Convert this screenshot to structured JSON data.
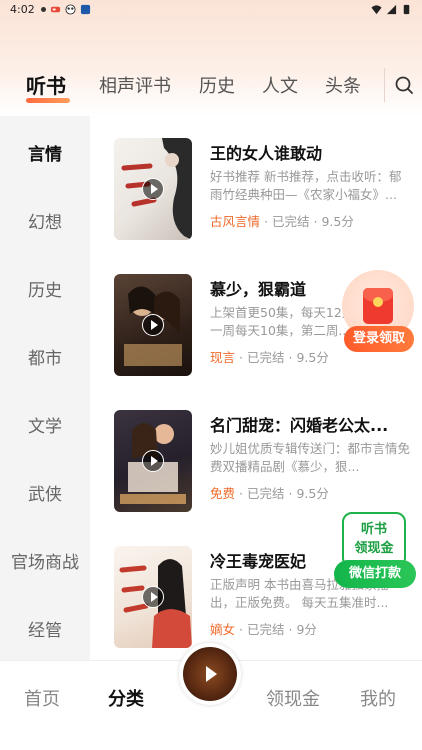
{
  "status_bar": {
    "time": "4:02",
    "icons": [
      "dot-icon",
      "game-icon",
      "panda-icon",
      "box-icon",
      "wifi-icon",
      "signal-icon",
      "battery-icon"
    ]
  },
  "top_tabs": {
    "items": [
      {
        "label": "听书",
        "active": true
      },
      {
        "label": "相声评书",
        "active": false
      },
      {
        "label": "历史",
        "active": false
      },
      {
        "label": "人文",
        "active": false
      },
      {
        "label": "头条",
        "active": false
      }
    ],
    "search_icon": "search-icon"
  },
  "categories": {
    "items": [
      {
        "label": "言情",
        "active": true
      },
      {
        "label": "幻想",
        "active": false
      },
      {
        "label": "历史",
        "active": false
      },
      {
        "label": "都市",
        "active": false
      },
      {
        "label": "文学",
        "active": false
      },
      {
        "label": "武侠",
        "active": false
      },
      {
        "label": "官场商战",
        "active": false
      },
      {
        "label": "经管",
        "active": false
      }
    ]
  },
  "books": [
    {
      "title": "王的女人谁敢动",
      "desc": "好书推荐 新书推荐，点击收听：郁雨竹经典种田—《农家小福女》...",
      "category": "古风言情",
      "status": "已完结",
      "score": "9.5分",
      "cover_colors": [
        "#f3f1ec",
        "#b8322c"
      ]
    },
    {
      "title": "慕少，狠霸道",
      "desc": "上架首更50集，每天12点更新，第一周每天10集，第二周...",
      "category": "现言",
      "status": "已完结",
      "score": "9.5分",
      "cover_colors": [
        "#3a2a22",
        "#e2b070"
      ]
    },
    {
      "title": "名门甜宠：闪婚老公太...",
      "desc": "妙儿姐优质专辑传送门：都市言情免费双播精品剧《慕少，狠...",
      "category": "免费",
      "status": "已完结",
      "score": "9.5分",
      "cover_colors": [
        "#2a2632",
        "#f0c4a8"
      ]
    },
    {
      "title": "冷王毒宠医妃",
      "desc": "正版声明 本书由喜马拉雅独家播出，正版免费。 每天五集准时...",
      "category": "嫡女",
      "status": "已完结",
      "score": "9分",
      "cover_colors": [
        "#f4ede6",
        "#c23a2c"
      ]
    }
  ],
  "meta_separator": "·",
  "floating_redpacket": {
    "label": "登录领取",
    "icon": "red-envelope-icon"
  },
  "floating_cash": {
    "line1": "听书",
    "line2": "领现金",
    "button": "微信打款"
  },
  "bottom_nav": {
    "items": [
      {
        "label": "首页",
        "active": false
      },
      {
        "label": "分类",
        "active": true
      },
      {
        "label": "领现金",
        "active": false
      },
      {
        "label": "我的",
        "active": false
      }
    ],
    "player_icon": "play-icon"
  },
  "colors": {
    "accent": "#ff6a3d",
    "category_text": "#f06a2a",
    "green": "#13b54a",
    "red": "#ef3b2f"
  }
}
